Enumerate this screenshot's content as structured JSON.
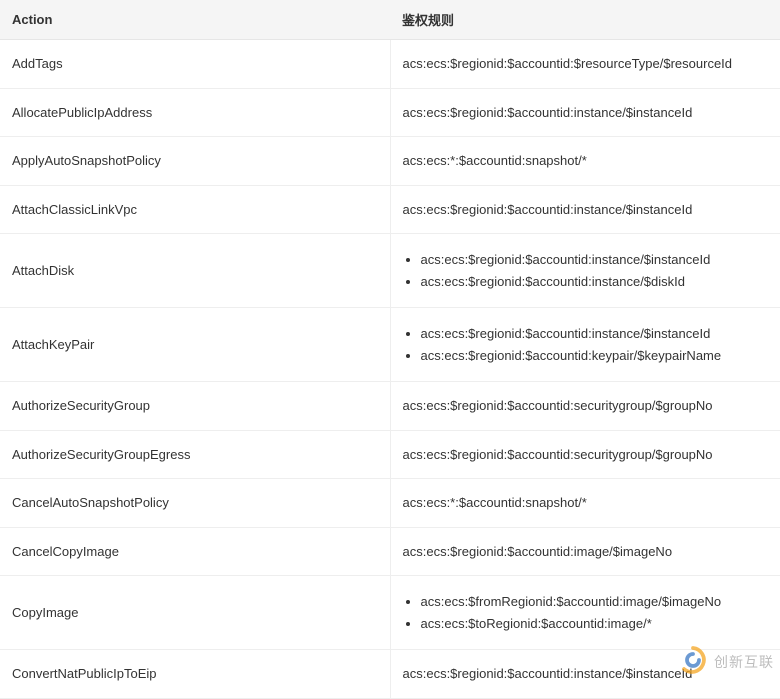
{
  "headers": {
    "action": "Action",
    "rule": "鉴权规则"
  },
  "rows": [
    {
      "action": "AddTags",
      "rules": [
        "acs:ecs:$regionid:$accountid:$resourceType/$resourceId"
      ]
    },
    {
      "action": "AllocatePublicIpAddress",
      "rules": [
        "acs:ecs:$regionid:$accountid:instance/$instanceId"
      ]
    },
    {
      "action": "ApplyAutoSnapshotPolicy",
      "rules": [
        "acs:ecs:*:$accountid:snapshot/*"
      ]
    },
    {
      "action": "AttachClassicLinkVpc",
      "rules": [
        "acs:ecs:$regionid:$accountid:instance/$instanceId"
      ]
    },
    {
      "action": "AttachDisk",
      "rules": [
        "acs:ecs:$regionid:$accountid:instance/$instanceId",
        "acs:ecs:$regionid:$accountid:instance/$diskId"
      ]
    },
    {
      "action": "AttachKeyPair",
      "rules": [
        "acs:ecs:$regionid:$accountid:instance/$instanceId",
        "acs:ecs:$regionid:$accountid:keypair/$keypairName"
      ]
    },
    {
      "action": "AuthorizeSecurityGroup",
      "rules": [
        "acs:ecs:$regionid:$accountid:securitygroup/$groupNo"
      ]
    },
    {
      "action": "AuthorizeSecurityGroupEgress",
      "rules": [
        "acs:ecs:$regionid:$accountid:securitygroup/$groupNo"
      ]
    },
    {
      "action": "CancelAutoSnapshotPolicy",
      "rules": [
        "acs:ecs:*:$accountid:snapshot/*"
      ]
    },
    {
      "action": "CancelCopyImage",
      "rules": [
        "acs:ecs:$regionid:$accountid:image/$imageNo"
      ]
    },
    {
      "action": "CopyImage",
      "rules": [
        "acs:ecs:$fromRegionid:$accountid:image/$imageNo",
        "acs:ecs:$toRegionid:$accountid:image/*"
      ]
    },
    {
      "action": "ConvertNatPublicIpToEip",
      "rules": [
        "acs:ecs:$regionid:$accountid:instance/$instanceId"
      ]
    }
  ],
  "watermark": {
    "text": "创新互联",
    "accent": "#f5a623",
    "accent2": "#3b78c4"
  }
}
